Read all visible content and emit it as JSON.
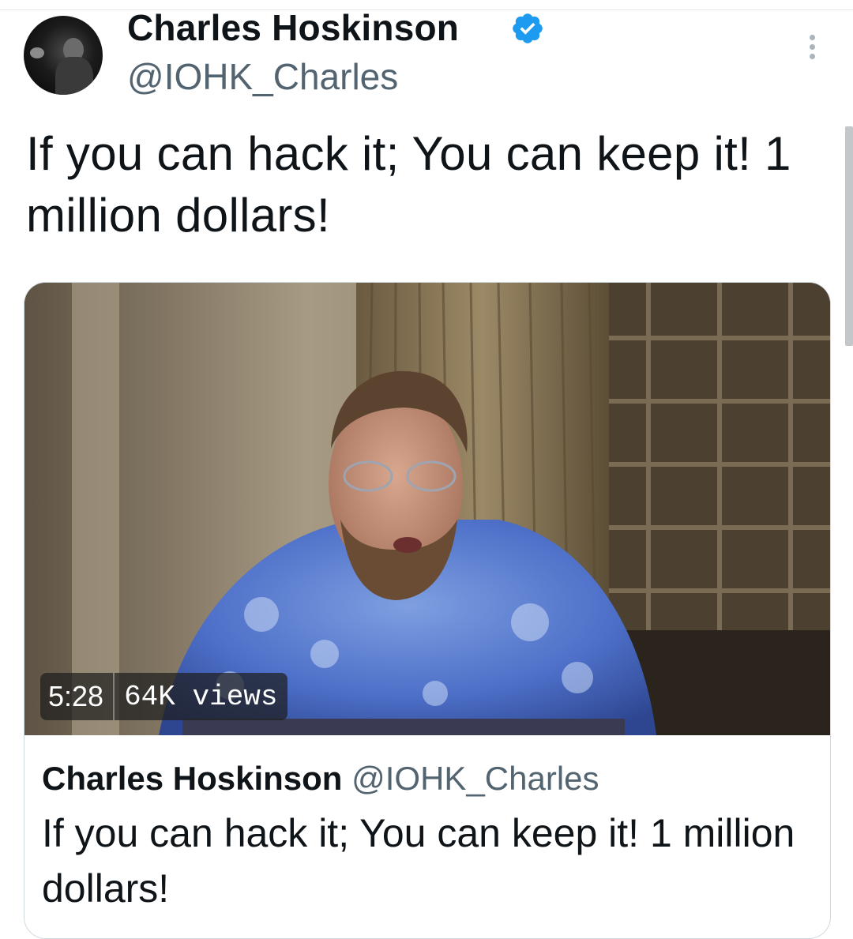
{
  "author": {
    "display_name": "Charles Hoskinson",
    "handle": "@IOHK_Charles",
    "verified": true,
    "verified_color": "#1d9bf0"
  },
  "tweet": {
    "text": "If you can hack it; You can keep it! 1 million dollars!"
  },
  "video": {
    "duration": "5:28",
    "views": "64K views"
  },
  "card": {
    "author_name": "Charles Hoskinson",
    "author_handle": "@IOHK_Charles",
    "text": "If you can hack it; You can keep it! 1 million dollars!"
  },
  "icons": {
    "verified": "verified-badge-icon",
    "more": "more-vertical-icon"
  }
}
